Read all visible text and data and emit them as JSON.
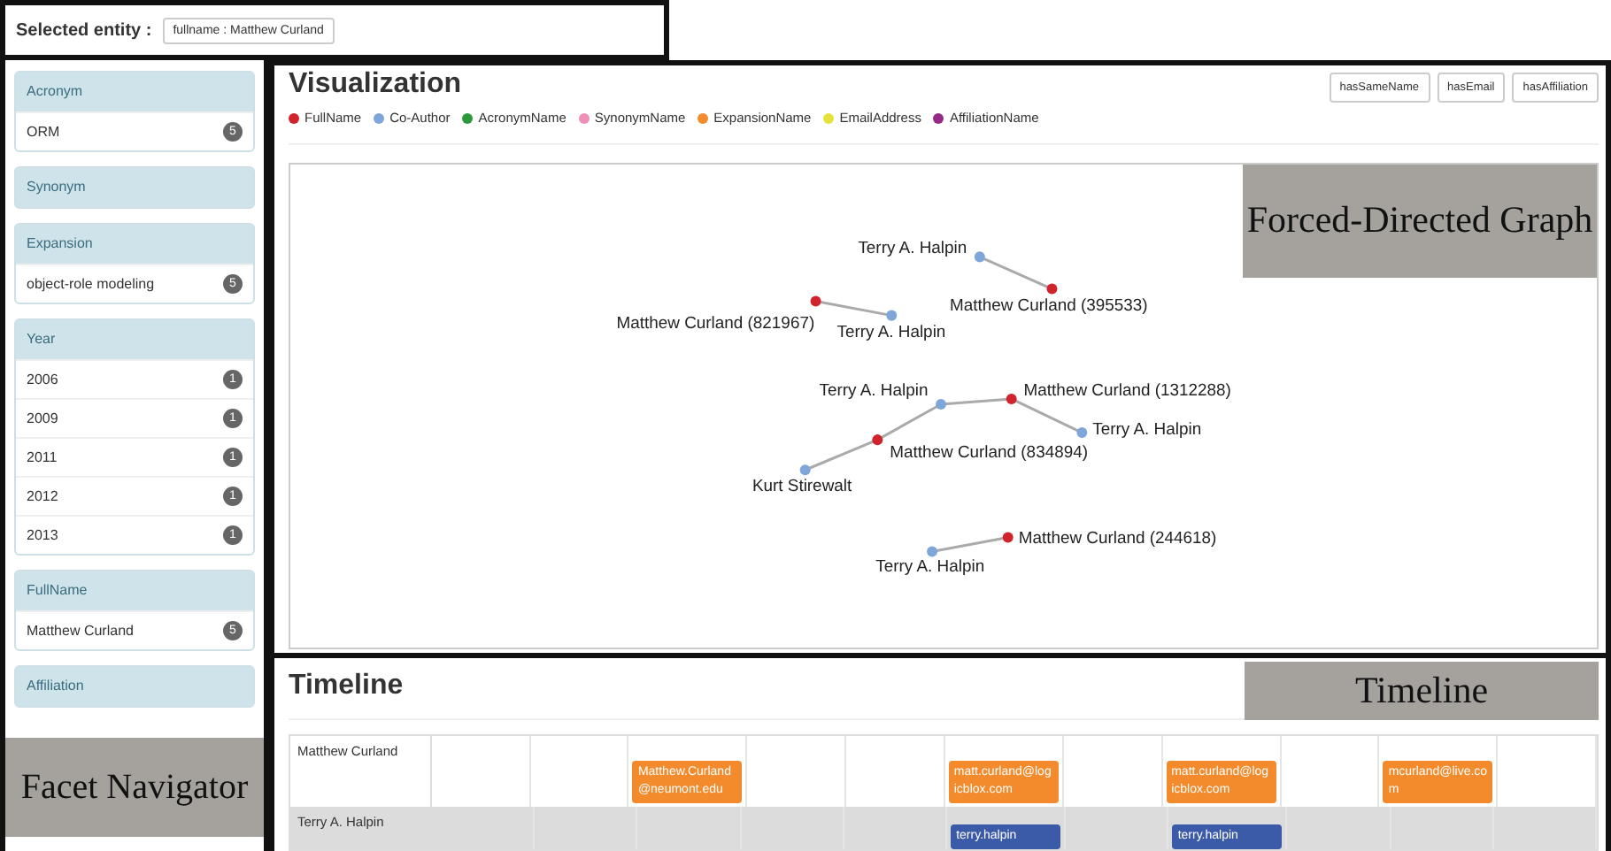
{
  "selected_entity": {
    "label": "Selected entity :",
    "value": "fullname : Matthew Curland"
  },
  "facets": [
    {
      "title": "Acronym",
      "items": [
        {
          "label": "ORM",
          "count": "5"
        }
      ]
    },
    {
      "title": "Synonym"
    },
    {
      "title": "Expansion",
      "items": [
        {
          "label": "object-role modeling",
          "count": "5"
        }
      ]
    },
    {
      "title": "Year",
      "items": [
        {
          "label": "2006",
          "count": "1"
        },
        {
          "label": "2009",
          "count": "1"
        },
        {
          "label": "2011",
          "count": "1"
        },
        {
          "label": "2012",
          "count": "1"
        },
        {
          "label": "2013",
          "count": "1"
        }
      ]
    },
    {
      "title": "FullName",
      "items": [
        {
          "label": "Matthew Curland",
          "count": "5"
        }
      ]
    },
    {
      "title": "Affiliation"
    }
  ],
  "visualization": {
    "title": "Visualization",
    "buttons": [
      "hasSameName",
      "hasEmail",
      "hasAffiliation"
    ],
    "legend": [
      {
        "label": "FullName",
        "color": "#d0232b"
      },
      {
        "label": "Co-Author",
        "color": "#7ea6da"
      },
      {
        "label": "AcronymName",
        "color": "#2a9a3a"
      },
      {
        "label": "SynonymName",
        "color": "#ee8fb8"
      },
      {
        "label": "ExpansionName",
        "color": "#f38a2b"
      },
      {
        "label": "EmailAddress",
        "color": "#e6e23c"
      },
      {
        "label": "AffiliationName",
        "color": "#952a88"
      }
    ],
    "nodes": [
      {
        "label": "Terry A. Halpin",
        "kind": "coauthor"
      },
      {
        "label": "Matthew Curland (395533)",
        "kind": "fullname"
      },
      {
        "label": "Matthew Curland (821967)",
        "kind": "fullname"
      },
      {
        "label": "Terry A. Halpin",
        "kind": "coauthor"
      },
      {
        "label": "Terry A. Halpin",
        "kind": "coauthor"
      },
      {
        "label": "Matthew Curland (1312288)",
        "kind": "fullname"
      },
      {
        "label": "Terry A. Halpin",
        "kind": "coauthor"
      },
      {
        "label": "Matthew Curland (834894)",
        "kind": "fullname"
      },
      {
        "label": "Kurt Stirewalt",
        "kind": "coauthor"
      },
      {
        "label": "Matthew Curland (244618)",
        "kind": "fullname"
      },
      {
        "label": "Terry A. Halpin",
        "kind": "coauthor"
      }
    ]
  },
  "timeline": {
    "title": "Timeline",
    "rows": [
      {
        "name": "Matthew Curland",
        "kind": "email",
        "cells": [
          null,
          null,
          "Matthew.Curland@neumont.edu",
          null,
          null,
          "matt.curland@logicblox.com",
          null,
          "matt.curland@logicblox.com",
          null,
          "mcurland@live.com",
          null
        ]
      },
      {
        "name": "Terry A. Halpin",
        "kind": "coauthor",
        "cells": [
          null,
          null,
          null,
          null,
          null,
          "terry.halpin",
          null,
          "terry.halpin",
          null,
          null,
          null
        ]
      }
    ]
  },
  "annotations": {
    "graph": "Forced-Directed Graph",
    "timeline": "Timeline",
    "facets": "Facet Navigator"
  }
}
